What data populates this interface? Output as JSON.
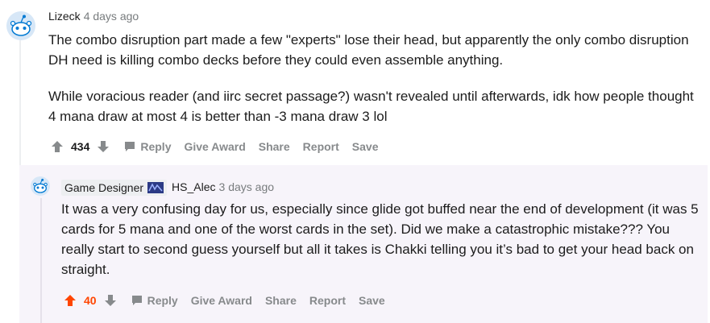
{
  "comment": {
    "author": "Lizeck",
    "time": "4 days ago",
    "paragraphs": [
      "The combo disruption part made a few \"experts\" lose their head, but apparently the only combo disruption DH need is killing combo decks before they could even assemble anything.",
      "While voracious reader (and iirc secret passage?) wasn't revealed until afterwards, idk how people thought 4 mana draw at most 4 is better than -3 mana draw 3 lol"
    ],
    "score": "434",
    "vote_state": "none",
    "actions": {
      "reply": "Reply",
      "give_award": "Give Award",
      "share": "Share",
      "report": "Report",
      "save": "Save"
    }
  },
  "reply": {
    "flair": "Game Designer",
    "author": "HS_Alec",
    "time": "3 days ago",
    "paragraphs": [
      "It was a very confusing day for us, especially since glide got buffed near the end of development (it was 5 cards for 5 mana and one of the worst cards in the set). Did we make a catastrophic mistake??? You really start to second guess yourself but all it takes is Chakki telling you it’s bad to get your head back on straight."
    ],
    "score": "40",
    "vote_state": "upvoted",
    "actions": {
      "reply": "Reply",
      "give_award": "Give Award",
      "share": "Share",
      "report": "Report",
      "save": "Save"
    }
  },
  "colors": {
    "upvote_active": "#ff4500",
    "icon_gray": "#878a8c",
    "reply_bg": "#f7f4fa",
    "thread_line": "#edeff1",
    "avatar_blue": "#0079d3"
  }
}
